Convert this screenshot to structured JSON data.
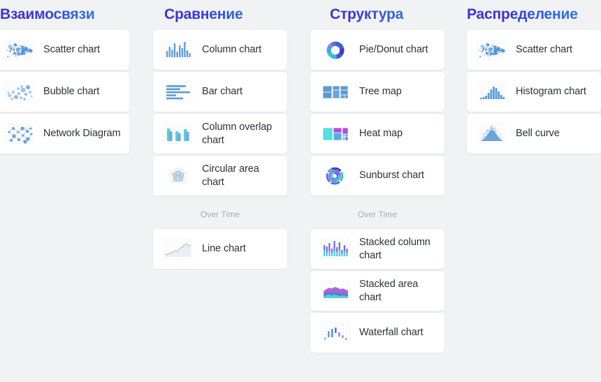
{
  "colors": {
    "background": "#f1f2f4",
    "card": "#ffffff",
    "title_gradient_start": "#3b32d4",
    "title_gradient_end": "#2f7ae6",
    "label_text": "#2f3136",
    "subhead_text": "#a6a9b4",
    "icon_blue": "#5b9bd5",
    "icon_indigo": "#4040c8",
    "icon_cyan": "#53dfe0",
    "icon_purple": "#b44ae0"
  },
  "columns": [
    {
      "title": "Взаимосвязи",
      "cards": [
        {
          "label": "Scatter chart",
          "icon": "scatter-chart-icon"
        },
        {
          "label": "Bubble chart",
          "icon": "bubble-chart-icon"
        },
        {
          "label": "Network Diagram",
          "icon": "network-diagram-icon"
        }
      ],
      "subsection": null,
      "subsection_cards": []
    },
    {
      "title": "Сравнение",
      "cards": [
        {
          "label": "Column chart",
          "icon": "column-chart-icon"
        },
        {
          "label": "Bar chart",
          "icon": "bar-chart-icon"
        },
        {
          "label": "Column overlap chart",
          "icon": "column-overlap-chart-icon"
        },
        {
          "label": "Circular area chart",
          "icon": "circular-area-chart-icon"
        }
      ],
      "subsection": "Over Time",
      "subsection_cards": [
        {
          "label": "Line chart",
          "icon": "line-chart-icon"
        }
      ]
    },
    {
      "title": "Структура",
      "cards": [
        {
          "label": "Pie/Donut chart",
          "icon": "pie-donut-chart-icon"
        },
        {
          "label": "Tree map",
          "icon": "tree-map-icon"
        },
        {
          "label": "Heat map",
          "icon": "heat-map-icon"
        },
        {
          "label": "Sunburst chart",
          "icon": "sunburst-chart-icon"
        }
      ],
      "subsection": "Over Time",
      "subsection_cards": [
        {
          "label": "Stacked column chart",
          "icon": "stacked-column-chart-icon"
        },
        {
          "label": "Stacked area chart",
          "icon": "stacked-area-chart-icon"
        },
        {
          "label": "Waterfall chart",
          "icon": "waterfall-chart-icon"
        }
      ]
    },
    {
      "title": "Распределение",
      "cards": [
        {
          "label": "Scatter chart",
          "icon": "scatter-chart-icon"
        },
        {
          "label": "Histogram chart",
          "icon": "histogram-chart-icon"
        },
        {
          "label": "Bell curve",
          "icon": "bell-curve-icon"
        }
      ],
      "subsection": null,
      "subsection_cards": []
    }
  ]
}
